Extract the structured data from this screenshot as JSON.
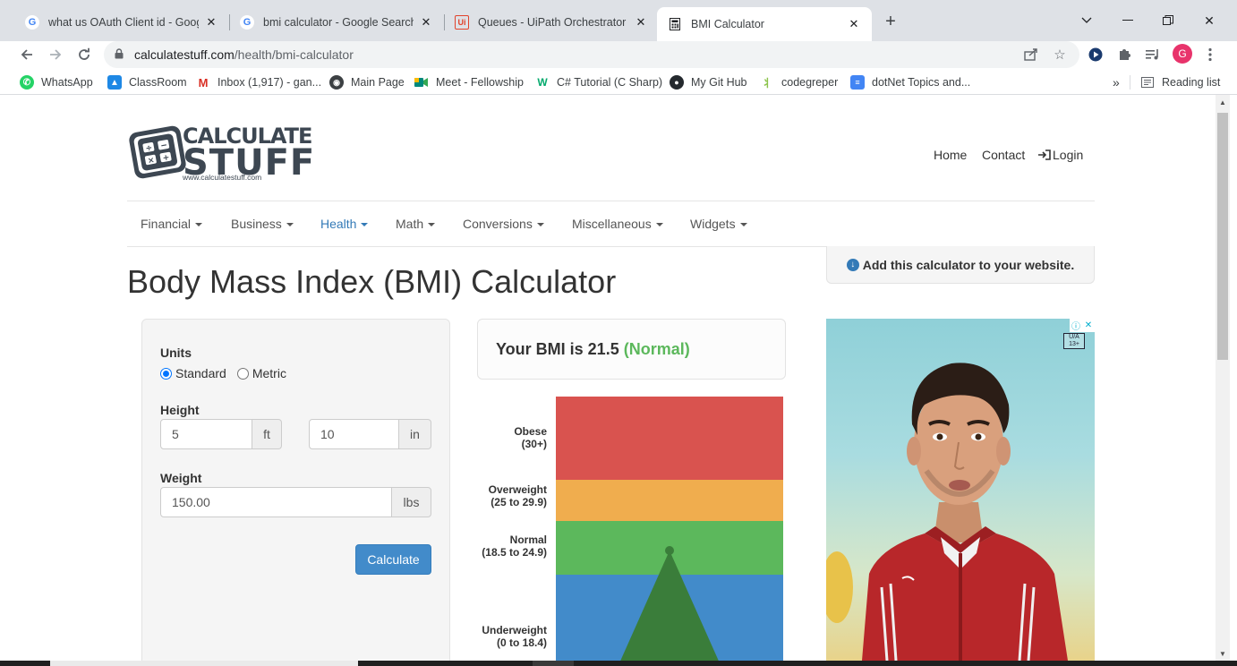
{
  "browser": {
    "tabs": [
      {
        "title": "what us OAuth Client id - Google",
        "favicon": "google-icon"
      },
      {
        "title": "bmi calculator - Google Search",
        "favicon": "google-icon"
      },
      {
        "title": "Queues - UiPath Orchestrator",
        "favicon": "uipath-icon"
      },
      {
        "title": "BMI Calculator",
        "favicon": "calculator-icon",
        "active": true
      }
    ],
    "url_domain": "calculatestuff.com",
    "url_path": "/health/bmi-calculator",
    "profile_initial": "G",
    "bookmarks": [
      {
        "label": "WhatsApp",
        "icon": "whatsapp-icon",
        "color": "#25d366"
      },
      {
        "label": "ClassRoom",
        "icon": "classroom-icon",
        "color": "#1e88e5"
      },
      {
        "label": "Inbox (1,917) - gan...",
        "icon": "gmail-icon",
        "color": "#d93025"
      },
      {
        "label": "Main Page",
        "icon": "globe-icon",
        "color": "#5f6368"
      },
      {
        "label": "Meet - Fellowship",
        "icon": "meet-icon",
        "color": "#00897b"
      },
      {
        "label": "C# Tutorial (C Sharp)",
        "icon": "w3schools-icon",
        "color": "#04aa6d"
      },
      {
        "label": "My Git Hub",
        "icon": "github-icon",
        "color": "#24292e"
      },
      {
        "label": "codegreper",
        "icon": "codegreper-icon",
        "color": "#8bc34a"
      },
      {
        "label": "dotNet Topics and...",
        "icon": "docs-icon",
        "color": "#4285f4"
      }
    ],
    "bookmarks_overflow": "»",
    "reading_list": "Reading list"
  },
  "site": {
    "logo_line1": "CALCULATE",
    "logo_line2": "STUFF",
    "logo_url": "www.calculatestuff.com",
    "topnav": {
      "home": "Home",
      "contact": "Contact",
      "login": "Login"
    },
    "mainnav": [
      {
        "label": "Financial"
      },
      {
        "label": "Business"
      },
      {
        "label": "Health",
        "active": true
      },
      {
        "label": "Math"
      },
      {
        "label": "Conversions"
      },
      {
        "label": "Miscellaneous"
      },
      {
        "label": "Widgets"
      }
    ],
    "add_widget": "Add this calculator to your website."
  },
  "calculator": {
    "title": "Body Mass Index (BMI) Calculator",
    "units_label": "Units",
    "unit_standard": "Standard",
    "unit_metric": "Metric",
    "unit_selected": "Standard",
    "height_label": "Height",
    "height_ft": "5",
    "height_ft_unit": "ft",
    "height_in": "10",
    "height_in_unit": "in",
    "weight_label": "Weight",
    "weight_value": "150.00",
    "weight_unit": "lbs",
    "calculate_button": "Calculate",
    "result_prefix": "Your BMI is 21.5",
    "result_category": "(Normal)",
    "bmi_value": 21.5,
    "colors": {
      "obese": "#d9534f",
      "overweight": "#f0ad4e",
      "normal": "#5cb85c",
      "underweight": "#428bca",
      "pointer": "#3a7d3a",
      "result_category": "#5cb85c"
    }
  },
  "scale_labels": {
    "obese": [
      "Obese",
      "(30+)"
    ],
    "overweight": [
      "Overweight",
      "(25 to 29.9)"
    ],
    "normal": [
      "Normal",
      "(18.5 to 24.9)"
    ],
    "underweight": [
      "Underweight",
      "(0 to 18.4)"
    ]
  },
  "ad": {
    "rating_line1": "U/A",
    "rating_line2": "13+"
  }
}
